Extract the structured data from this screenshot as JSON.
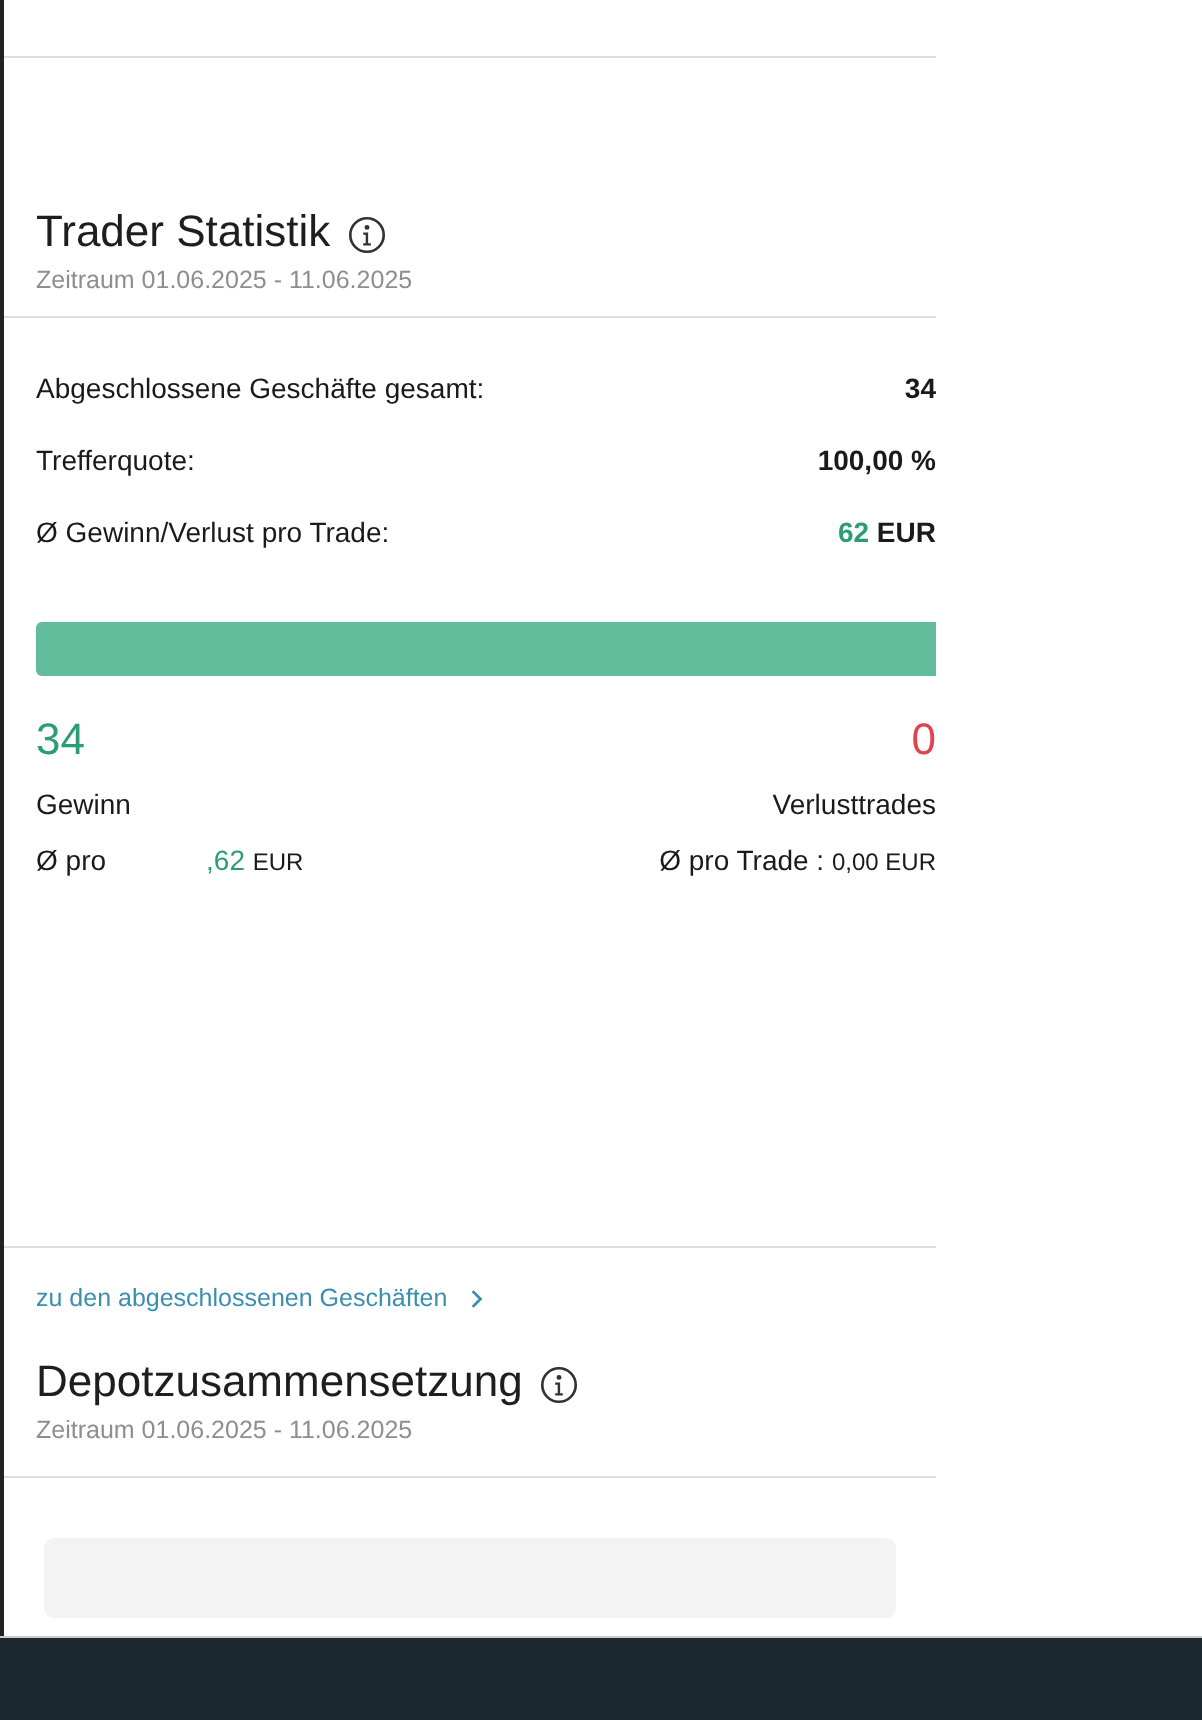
{
  "trader_statistik": {
    "title": "Trader Statistik",
    "period": "Zeitraum 01.06.2025 - 11.06.2025",
    "rows": [
      {
        "label": "Abgeschlossene Geschäfte gesamt:",
        "value": "34",
        "kind": "plain"
      },
      {
        "label": "Trefferquote:",
        "value": "100,00 %",
        "kind": "plain"
      },
      {
        "label": "Ø Gewinn/Verlust pro Trade:",
        "value": "62",
        "unit": "EUR",
        "kind": "money"
      }
    ],
    "win_bar": {
      "level": 1.0
    },
    "wins": {
      "count": "34",
      "label": "Gewinn",
      "avg_label": "Ø pro",
      "avg_value": ",62",
      "avg_unit": "EUR"
    },
    "losses": {
      "count": "0",
      "label": "Verlusttrades",
      "avg_label": "Ø pro Trade :",
      "avg_value": "0,00",
      "avg_unit": "EUR"
    },
    "link": "zu den abgeschlossenen Geschäften"
  },
  "depotzusammensetzung": {
    "title": "Depotzusammensetzung",
    "period": "Zeitraum 01.06.2025 - 11.06.2025"
  }
}
